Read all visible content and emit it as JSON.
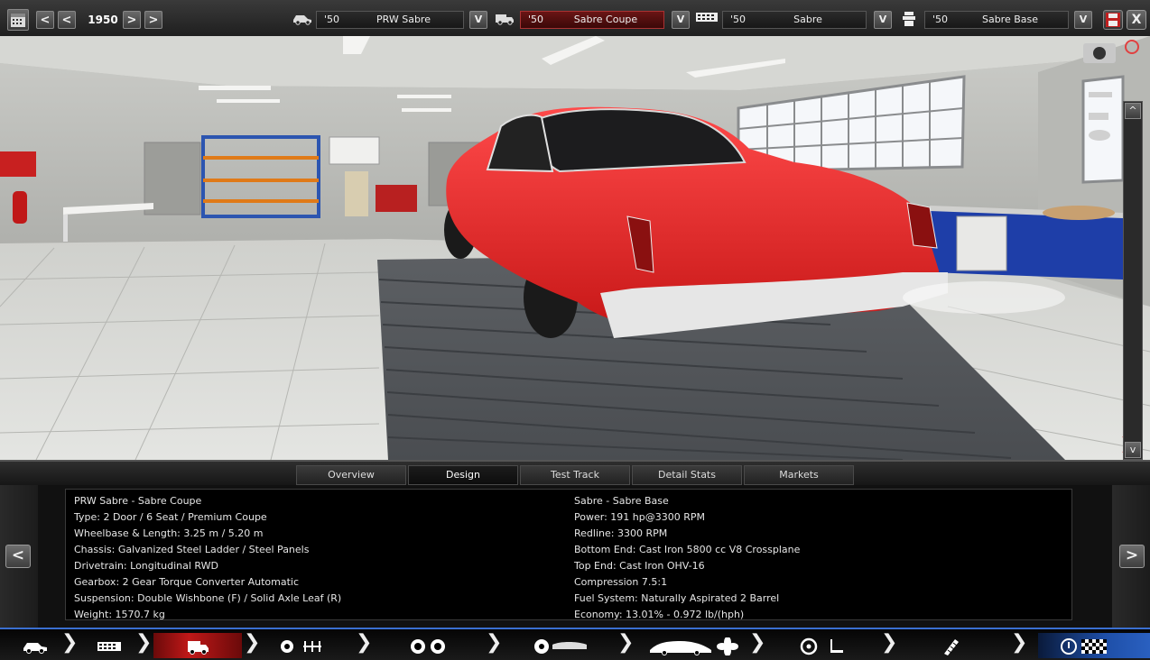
{
  "toolbar": {
    "year": "1950",
    "prev_fast": "<",
    "prev": "<",
    "next": ">",
    "next_fast": ">",
    "close": "X"
  },
  "selectors": [
    {
      "icon": "company-car-icon",
      "year": "'50",
      "name": "PRW Sabre",
      "active": false
    },
    {
      "icon": "model-van-icon",
      "year": "'50",
      "name": "Sabre Coupe",
      "active": true
    },
    {
      "icon": "engine-block-icon",
      "year": "'50",
      "name": "Sabre",
      "active": false
    },
    {
      "icon": "engine-variant-icon",
      "year": "'50",
      "name": "Sabre Base",
      "active": false
    }
  ],
  "dropdown_label": "V",
  "tabs": [
    "Overview",
    "Design",
    "Test Track",
    "Detail Stats",
    "Markets"
  ],
  "active_tab": "Design",
  "info": {
    "left": [
      "PRW Sabre - Sabre Coupe",
      "Type: 2 Door / 6 Seat / Premium Coupe",
      "Wheelbase & Length: 3.25 m / 5.20 m",
      "Chassis: Galvanized Steel Ladder / Steel Panels",
      "Drivetrain: Longitudinal RWD",
      "Gearbox: 2 Gear Torque Converter Automatic",
      "Suspension: Double Wishbone (F) / Solid Axle Leaf (R)",
      "Weight: 1570.7 kg"
    ],
    "right": [
      "Sabre - Sabre Base",
      "Power: 191 hp@3300 RPM",
      "Redline: 3300 RPM",
      "Bottom End: Cast Iron 5800 cc V8 Crossplane",
      "Top End: Cast Iron OHV-16",
      "Compression 7.5:1",
      "Fuel System: Naturally Aspirated 2 Barrel",
      "Economy: 13.01% - 0.972 lb/(hph)"
    ],
    "prev_label": "<",
    "next_label": ">"
  },
  "scroll": {
    "up": "^",
    "down": "v"
  },
  "nav": {
    "chevron": "❯"
  },
  "colors": {
    "accent_blue": "#3a6fd0",
    "car_red": "#e02a2a",
    "active_red": "#c01818"
  }
}
